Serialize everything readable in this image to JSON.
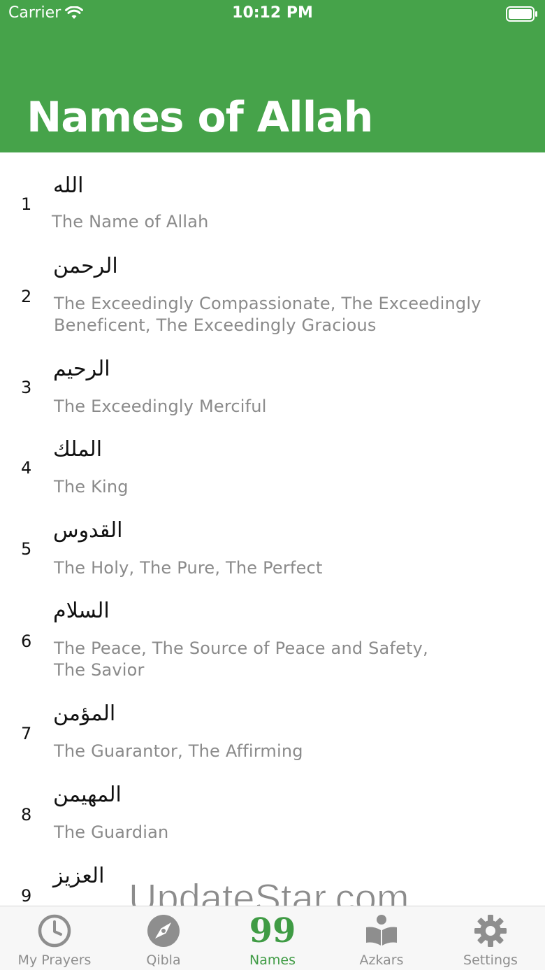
{
  "status_bar": {
    "carrier": "Carrier",
    "time": "10:12 PM"
  },
  "header": {
    "title": "Names of Allah",
    "background_color": "#46a34a"
  },
  "names": [
    {
      "number": "1",
      "arabic": "الله",
      "meaning": "The Name of Allah"
    },
    {
      "number": "2",
      "arabic": "الرحمن",
      "meaning": "The Exceedingly Compassionate, The Exceedingly Beneficent, The Exceedingly Gracious"
    },
    {
      "number": "3",
      "arabic": "الرحيم",
      "meaning": "The Exceedingly Merciful"
    },
    {
      "number": "4",
      "arabic": "الملك",
      "meaning": "The King"
    },
    {
      "number": "5",
      "arabic": "القدوس",
      "meaning": "The Holy, The Pure, The Perfect"
    },
    {
      "number": "6",
      "arabic": "السلام",
      "meaning": "The Peace, The Source of Peace and Safety, The Savior"
    },
    {
      "number": "7",
      "arabic": "المؤمن",
      "meaning": "The Guarantor, The Affirming"
    },
    {
      "number": "8",
      "arabic": "المهيمن",
      "meaning": "The Guardian"
    },
    {
      "number": "9",
      "arabic": "العزيز",
      "meaning": ""
    }
  ],
  "watermark": "UpdateStar.com",
  "tabbar": {
    "active_color": "#3f9b44",
    "inactive_color": "#8e8e8e",
    "tabs": [
      {
        "label": "My Prayers",
        "icon": "clock-icon"
      },
      {
        "label": "Qibla",
        "icon": "compass-icon"
      },
      {
        "label": "Names",
        "icon": "99-icon",
        "glyph": "99",
        "active": true
      },
      {
        "label": "Azkars",
        "icon": "book-reader-icon"
      },
      {
        "label": "Settings",
        "icon": "gear-icon"
      }
    ]
  }
}
